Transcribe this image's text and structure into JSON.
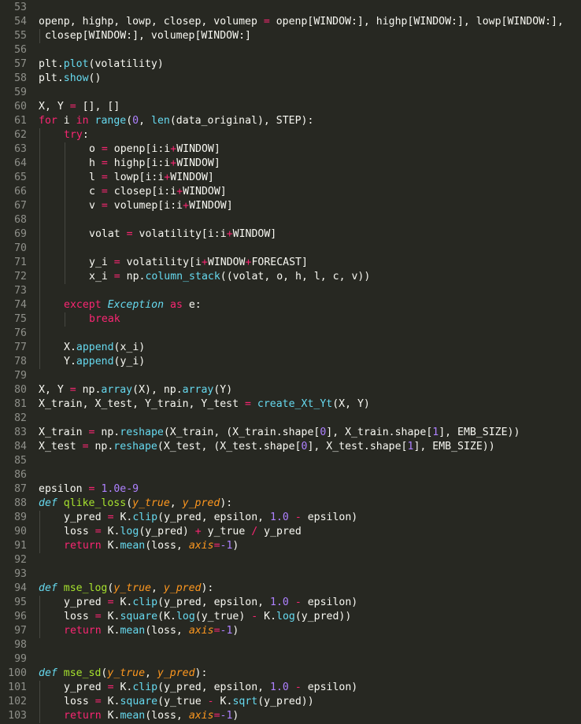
{
  "editor": {
    "theme_colors": {
      "background": "#272822",
      "foreground": "#f8f8f2",
      "gutter": "#8f908a",
      "keyword": "#f92672",
      "function": "#66d9ef",
      "number": "#ae81ff",
      "def_name": "#a6e22e",
      "parameter": "#fd971f"
    },
    "lines": [
      {
        "n": "53",
        "indent": 0,
        "tokens": []
      },
      {
        "n": "54",
        "indent": 0,
        "tokens": [
          [
            "plain",
            "openp, highp, lowp, closep, volumep "
          ],
          [
            "op",
            "="
          ],
          [
            "plain",
            " openp[WINDOW:], highp[WINDOW:], lowp[WINDOW:],"
          ]
        ]
      },
      {
        "n": "55",
        "indent": 0,
        "wrap": true,
        "tokens": [
          [
            "plain",
            " closep[WINDOW:], volumep[WINDOW:]"
          ]
        ]
      },
      {
        "n": "56",
        "indent": 0,
        "tokens": []
      },
      {
        "n": "57",
        "indent": 0,
        "tokens": [
          [
            "plain",
            "plt."
          ],
          [
            "fn",
            "plot"
          ],
          [
            "plain",
            "(volatility)"
          ]
        ]
      },
      {
        "n": "58",
        "indent": 0,
        "tokens": [
          [
            "plain",
            "plt."
          ],
          [
            "fn",
            "show"
          ],
          [
            "plain",
            "()"
          ]
        ]
      },
      {
        "n": "59",
        "indent": 0,
        "tokens": []
      },
      {
        "n": "60",
        "indent": 0,
        "tokens": [
          [
            "plain",
            "X, Y "
          ],
          [
            "op",
            "="
          ],
          [
            "plain",
            " [], []"
          ]
        ]
      },
      {
        "n": "61",
        "indent": 0,
        "tokens": [
          [
            "kw",
            "for"
          ],
          [
            "plain",
            " i "
          ],
          [
            "kw",
            "in"
          ],
          [
            "plain",
            " "
          ],
          [
            "fn",
            "range"
          ],
          [
            "plain",
            "("
          ],
          [
            "num",
            "0"
          ],
          [
            "plain",
            ", "
          ],
          [
            "fn",
            "len"
          ],
          [
            "plain",
            "(data_original), STEP):"
          ]
        ]
      },
      {
        "n": "62",
        "indent": 1,
        "tokens": [
          [
            "kw",
            "try"
          ],
          [
            "plain",
            ":"
          ]
        ]
      },
      {
        "n": "63",
        "indent": 2,
        "tokens": [
          [
            "plain",
            "o "
          ],
          [
            "op",
            "="
          ],
          [
            "plain",
            " openp[i:i"
          ],
          [
            "op",
            "+"
          ],
          [
            "plain",
            "WINDOW]"
          ]
        ]
      },
      {
        "n": "64",
        "indent": 2,
        "tokens": [
          [
            "plain",
            "h "
          ],
          [
            "op",
            "="
          ],
          [
            "plain",
            " highp[i:i"
          ],
          [
            "op",
            "+"
          ],
          [
            "plain",
            "WINDOW]"
          ]
        ]
      },
      {
        "n": "65",
        "indent": 2,
        "tokens": [
          [
            "plain",
            "l "
          ],
          [
            "op",
            "="
          ],
          [
            "plain",
            " lowp[i:i"
          ],
          [
            "op",
            "+"
          ],
          [
            "plain",
            "WINDOW]"
          ]
        ]
      },
      {
        "n": "66",
        "indent": 2,
        "tokens": [
          [
            "plain",
            "c "
          ],
          [
            "op",
            "="
          ],
          [
            "plain",
            " closep[i:i"
          ],
          [
            "op",
            "+"
          ],
          [
            "plain",
            "WINDOW]"
          ]
        ]
      },
      {
        "n": "67",
        "indent": 2,
        "tokens": [
          [
            "plain",
            "v "
          ],
          [
            "op",
            "="
          ],
          [
            "plain",
            " volumep[i:i"
          ],
          [
            "op",
            "+"
          ],
          [
            "plain",
            "WINDOW]"
          ]
        ]
      },
      {
        "n": "68",
        "indent": 2,
        "guides": 2,
        "tokens": []
      },
      {
        "n": "69",
        "indent": 2,
        "tokens": [
          [
            "plain",
            "volat "
          ],
          [
            "op",
            "="
          ],
          [
            "plain",
            " volatility[i:i"
          ],
          [
            "op",
            "+"
          ],
          [
            "plain",
            "WINDOW]"
          ]
        ]
      },
      {
        "n": "70",
        "indent": 2,
        "guides": 2,
        "tokens": []
      },
      {
        "n": "71",
        "indent": 2,
        "tokens": [
          [
            "plain",
            "y_i "
          ],
          [
            "op",
            "="
          ],
          [
            "plain",
            " volatility[i"
          ],
          [
            "op",
            "+"
          ],
          [
            "plain",
            "WINDOW"
          ],
          [
            "op",
            "+"
          ],
          [
            "plain",
            "FORECAST]"
          ]
        ]
      },
      {
        "n": "72",
        "indent": 2,
        "tokens": [
          [
            "plain",
            "x_i "
          ],
          [
            "op",
            "="
          ],
          [
            "plain",
            " np."
          ],
          [
            "fn",
            "column_stack"
          ],
          [
            "plain",
            "((volat, o, h, l, c, v))"
          ]
        ]
      },
      {
        "n": "73",
        "indent": 1,
        "guides": 1,
        "tokens": []
      },
      {
        "n": "74",
        "indent": 1,
        "tokens": [
          [
            "kw",
            "except"
          ],
          [
            "plain",
            " "
          ],
          [
            "cls",
            "Exception"
          ],
          [
            "plain",
            " "
          ],
          [
            "kw",
            "as"
          ],
          [
            "plain",
            " e:"
          ]
        ]
      },
      {
        "n": "75",
        "indent": 2,
        "tokens": [
          [
            "kw",
            "break"
          ]
        ]
      },
      {
        "n": "76",
        "indent": 1,
        "guides": 1,
        "tokens": []
      },
      {
        "n": "77",
        "indent": 1,
        "tokens": [
          [
            "plain",
            "X."
          ],
          [
            "fn",
            "append"
          ],
          [
            "plain",
            "(x_i)"
          ]
        ]
      },
      {
        "n": "78",
        "indent": 1,
        "tokens": [
          [
            "plain",
            "Y."
          ],
          [
            "fn",
            "append"
          ],
          [
            "plain",
            "(y_i)"
          ]
        ]
      },
      {
        "n": "79",
        "indent": 0,
        "tokens": []
      },
      {
        "n": "80",
        "indent": 0,
        "tokens": [
          [
            "plain",
            "X, Y "
          ],
          [
            "op",
            "="
          ],
          [
            "plain",
            " np."
          ],
          [
            "fn",
            "array"
          ],
          [
            "plain",
            "(X), np."
          ],
          [
            "fn",
            "array"
          ],
          [
            "plain",
            "(Y)"
          ]
        ]
      },
      {
        "n": "81",
        "indent": 0,
        "tokens": [
          [
            "plain",
            "X_train, X_test, Y_train, Y_test "
          ],
          [
            "op",
            "="
          ],
          [
            "plain",
            " "
          ],
          [
            "fn",
            "create_Xt_Yt"
          ],
          [
            "plain",
            "(X, Y)"
          ]
        ]
      },
      {
        "n": "82",
        "indent": 0,
        "tokens": []
      },
      {
        "n": "83",
        "indent": 0,
        "tokens": [
          [
            "plain",
            "X_train "
          ],
          [
            "op",
            "="
          ],
          [
            "plain",
            " np."
          ],
          [
            "fn",
            "reshape"
          ],
          [
            "plain",
            "(X_train, (X_train.shape["
          ],
          [
            "num",
            "0"
          ],
          [
            "plain",
            "], X_train.shape["
          ],
          [
            "num",
            "1"
          ],
          [
            "plain",
            "], EMB_SIZE))"
          ]
        ]
      },
      {
        "n": "84",
        "indent": 0,
        "tokens": [
          [
            "plain",
            "X_test "
          ],
          [
            "op",
            "="
          ],
          [
            "plain",
            " np."
          ],
          [
            "fn",
            "reshape"
          ],
          [
            "plain",
            "(X_test, (X_test.shape["
          ],
          [
            "num",
            "0"
          ],
          [
            "plain",
            "], X_test.shape["
          ],
          [
            "num",
            "1"
          ],
          [
            "plain",
            "], EMB_SIZE))"
          ]
        ]
      },
      {
        "n": "85",
        "indent": 0,
        "tokens": []
      },
      {
        "n": "86",
        "indent": 0,
        "tokens": []
      },
      {
        "n": "87",
        "indent": 0,
        "tokens": [
          [
            "plain",
            "epsilon "
          ],
          [
            "op",
            "="
          ],
          [
            "plain",
            " "
          ],
          [
            "num",
            "1.0e-9"
          ]
        ]
      },
      {
        "n": "88",
        "indent": 0,
        "tokens": [
          [
            "def",
            "def"
          ],
          [
            "plain",
            " "
          ],
          [
            "defname",
            "qlike_loss"
          ],
          [
            "plain",
            "("
          ],
          [
            "param",
            "y_true"
          ],
          [
            "plain",
            ", "
          ],
          [
            "param",
            "y_pred"
          ],
          [
            "plain",
            "):"
          ]
        ]
      },
      {
        "n": "89",
        "indent": 1,
        "tokens": [
          [
            "plain",
            "y_pred "
          ],
          [
            "op",
            "="
          ],
          [
            "plain",
            " K."
          ],
          [
            "fn",
            "clip"
          ],
          [
            "plain",
            "(y_pred, epsilon, "
          ],
          [
            "num",
            "1.0"
          ],
          [
            "plain",
            " "
          ],
          [
            "op",
            "-"
          ],
          [
            "plain",
            " epsilon)"
          ]
        ]
      },
      {
        "n": "90",
        "indent": 1,
        "tokens": [
          [
            "plain",
            "loss "
          ],
          [
            "op",
            "="
          ],
          [
            "plain",
            " K."
          ],
          [
            "fn",
            "log"
          ],
          [
            "plain",
            "(y_pred) "
          ],
          [
            "op",
            "+"
          ],
          [
            "plain",
            " y_true "
          ],
          [
            "op",
            "/"
          ],
          [
            "plain",
            " y_pred"
          ]
        ]
      },
      {
        "n": "91",
        "indent": 1,
        "tokens": [
          [
            "kw",
            "return"
          ],
          [
            "plain",
            " K."
          ],
          [
            "fn",
            "mean"
          ],
          [
            "plain",
            "(loss, "
          ],
          [
            "param",
            "axis"
          ],
          [
            "op",
            "="
          ],
          [
            "num",
            "-1"
          ],
          [
            "plain",
            ")"
          ]
        ]
      },
      {
        "n": "92",
        "indent": 0,
        "tokens": []
      },
      {
        "n": "93",
        "indent": 0,
        "tokens": []
      },
      {
        "n": "94",
        "indent": 0,
        "tokens": [
          [
            "def",
            "def"
          ],
          [
            "plain",
            " "
          ],
          [
            "defname",
            "mse_log"
          ],
          [
            "plain",
            "("
          ],
          [
            "param",
            "y_true"
          ],
          [
            "plain",
            ", "
          ],
          [
            "param",
            "y_pred"
          ],
          [
            "plain",
            "):"
          ]
        ]
      },
      {
        "n": "95",
        "indent": 1,
        "tokens": [
          [
            "plain",
            "y_pred "
          ],
          [
            "op",
            "="
          ],
          [
            "plain",
            " K."
          ],
          [
            "fn",
            "clip"
          ],
          [
            "plain",
            "(y_pred, epsilon, "
          ],
          [
            "num",
            "1.0"
          ],
          [
            "plain",
            " "
          ],
          [
            "op",
            "-"
          ],
          [
            "plain",
            " epsilon)"
          ]
        ]
      },
      {
        "n": "96",
        "indent": 1,
        "tokens": [
          [
            "plain",
            "loss "
          ],
          [
            "op",
            "="
          ],
          [
            "plain",
            " K."
          ],
          [
            "fn",
            "square"
          ],
          [
            "plain",
            "(K."
          ],
          [
            "fn",
            "log"
          ],
          [
            "plain",
            "(y_true) "
          ],
          [
            "op",
            "-"
          ],
          [
            "plain",
            " K."
          ],
          [
            "fn",
            "log"
          ],
          [
            "plain",
            "(y_pred))"
          ]
        ]
      },
      {
        "n": "97",
        "indent": 1,
        "tokens": [
          [
            "kw",
            "return"
          ],
          [
            "plain",
            " K."
          ],
          [
            "fn",
            "mean"
          ],
          [
            "plain",
            "(loss, "
          ],
          [
            "param",
            "axis"
          ],
          [
            "op",
            "="
          ],
          [
            "num",
            "-1"
          ],
          [
            "plain",
            ")"
          ]
        ]
      },
      {
        "n": "98",
        "indent": 0,
        "tokens": []
      },
      {
        "n": "99",
        "indent": 0,
        "tokens": []
      },
      {
        "n": "100",
        "indent": 0,
        "tokens": [
          [
            "def",
            "def"
          ],
          [
            "plain",
            " "
          ],
          [
            "defname",
            "mse_sd"
          ],
          [
            "plain",
            "("
          ],
          [
            "param",
            "y_true"
          ],
          [
            "plain",
            ", "
          ],
          [
            "param",
            "y_pred"
          ],
          [
            "plain",
            "):"
          ]
        ]
      },
      {
        "n": "101",
        "indent": 1,
        "tokens": [
          [
            "plain",
            "y_pred "
          ],
          [
            "op",
            "="
          ],
          [
            "plain",
            " K."
          ],
          [
            "fn",
            "clip"
          ],
          [
            "plain",
            "(y_pred, epsilon, "
          ],
          [
            "num",
            "1.0"
          ],
          [
            "plain",
            " "
          ],
          [
            "op",
            "-"
          ],
          [
            "plain",
            " epsilon)"
          ]
        ]
      },
      {
        "n": "102",
        "indent": 1,
        "tokens": [
          [
            "plain",
            "loss "
          ],
          [
            "op",
            "="
          ],
          [
            "plain",
            " K."
          ],
          [
            "fn",
            "square"
          ],
          [
            "plain",
            "(y_true "
          ],
          [
            "op",
            "-"
          ],
          [
            "plain",
            " K."
          ],
          [
            "fn",
            "sqrt"
          ],
          [
            "plain",
            "(y_pred))"
          ]
        ]
      },
      {
        "n": "103",
        "indent": 1,
        "tokens": [
          [
            "kw",
            "return"
          ],
          [
            "plain",
            " K."
          ],
          [
            "fn",
            "mean"
          ],
          [
            "plain",
            "(loss, "
          ],
          [
            "param",
            "axis"
          ],
          [
            "op",
            "="
          ],
          [
            "num",
            "-1"
          ],
          [
            "plain",
            ")"
          ]
        ]
      }
    ]
  }
}
